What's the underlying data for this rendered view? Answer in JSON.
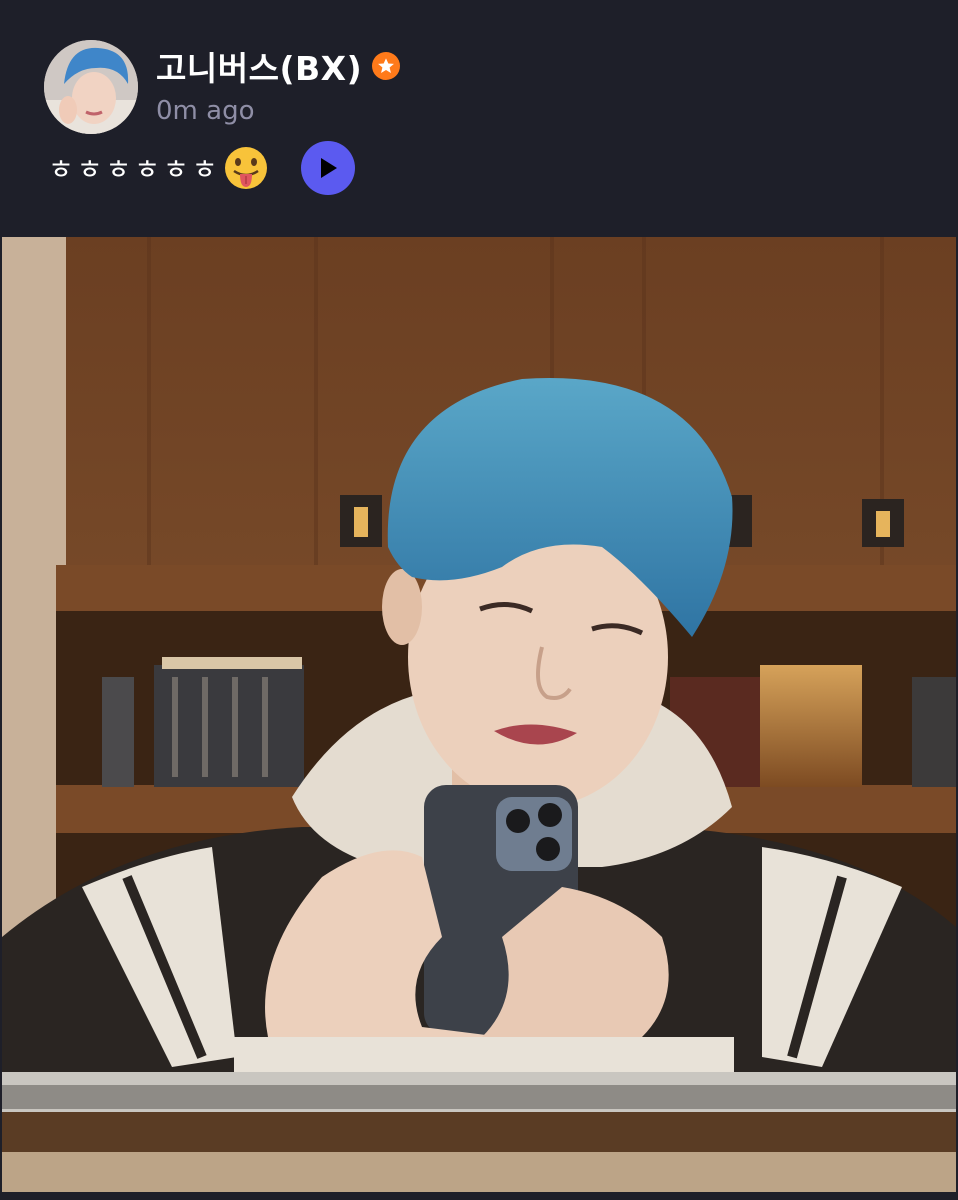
{
  "post": {
    "author": {
      "name": "고니버스(BX)",
      "badge": "star-badge-icon",
      "avatar_icon": "avatar-photo"
    },
    "timestamp": "0m ago",
    "message": {
      "text": "ㅎㅎㅎㅎㅎㅎ",
      "emoji": "face-with-tongue-icon"
    },
    "media": {
      "play_icon": "play-icon",
      "photo": "mirror-selfie-photo"
    }
  },
  "colors": {
    "background": "#1e1f29",
    "badge": "#ff7a1a",
    "play_button": "#5b5af0",
    "timestamp": "#8f8ea6",
    "hair": "#4a93b8"
  }
}
